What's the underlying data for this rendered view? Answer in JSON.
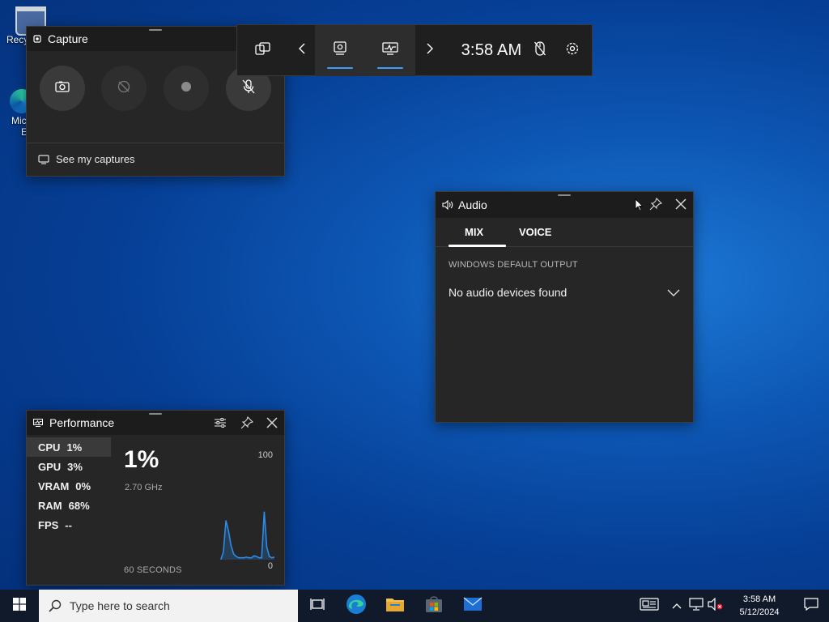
{
  "desktop": {
    "recycle_label": "Recy",
    "edge_label_1": "Mic",
    "edge_label_2": "E"
  },
  "capture": {
    "title": "Capture",
    "see_captures": "See my captures"
  },
  "gamebar": {
    "time": "3:58 AM",
    "accent_color": "#3aa0ff"
  },
  "audio": {
    "title": "Audio",
    "tabs": [
      {
        "label": "MIX"
      },
      {
        "label": "VOICE"
      }
    ],
    "output_label": "WINDOWS DEFAULT OUTPUT",
    "output_value": "No audio devices found"
  },
  "performance": {
    "title": "Performance",
    "metrics": [
      {
        "name": "CPU",
        "value": "1%"
      },
      {
        "name": "GPU",
        "value": "3%"
      },
      {
        "name": "VRAM",
        "value": "0%"
      },
      {
        "name": "RAM",
        "value": "68%"
      },
      {
        "name": "FPS",
        "value": "--"
      }
    ],
    "big_value": "1%",
    "freq": "2.70 GHz",
    "max_label": "100",
    "min_label": "0",
    "x_label": "60 SECONDS"
  },
  "chart_data": {
    "type": "area",
    "values": [
      0,
      0,
      0,
      0,
      0,
      0,
      0,
      0,
      0,
      0,
      0,
      0,
      0,
      0,
      0,
      0,
      0,
      0,
      0,
      0,
      0,
      0,
      0,
      0,
      0,
      0,
      0,
      0,
      0,
      0,
      0,
      0,
      0,
      0,
      0,
      0,
      0,
      0,
      0,
      12,
      62,
      45,
      22,
      9,
      5,
      3,
      3,
      3,
      4,
      3,
      3,
      6,
      5,
      3,
      3,
      76,
      20,
      5,
      3,
      4
    ],
    "ylim": [
      0,
      100
    ],
    "color": "#2b8be8"
  },
  "taskbar": {
    "search_placeholder": "Type here to search",
    "clock_time": "3:58 AM",
    "clock_date": "5/12/2024"
  }
}
